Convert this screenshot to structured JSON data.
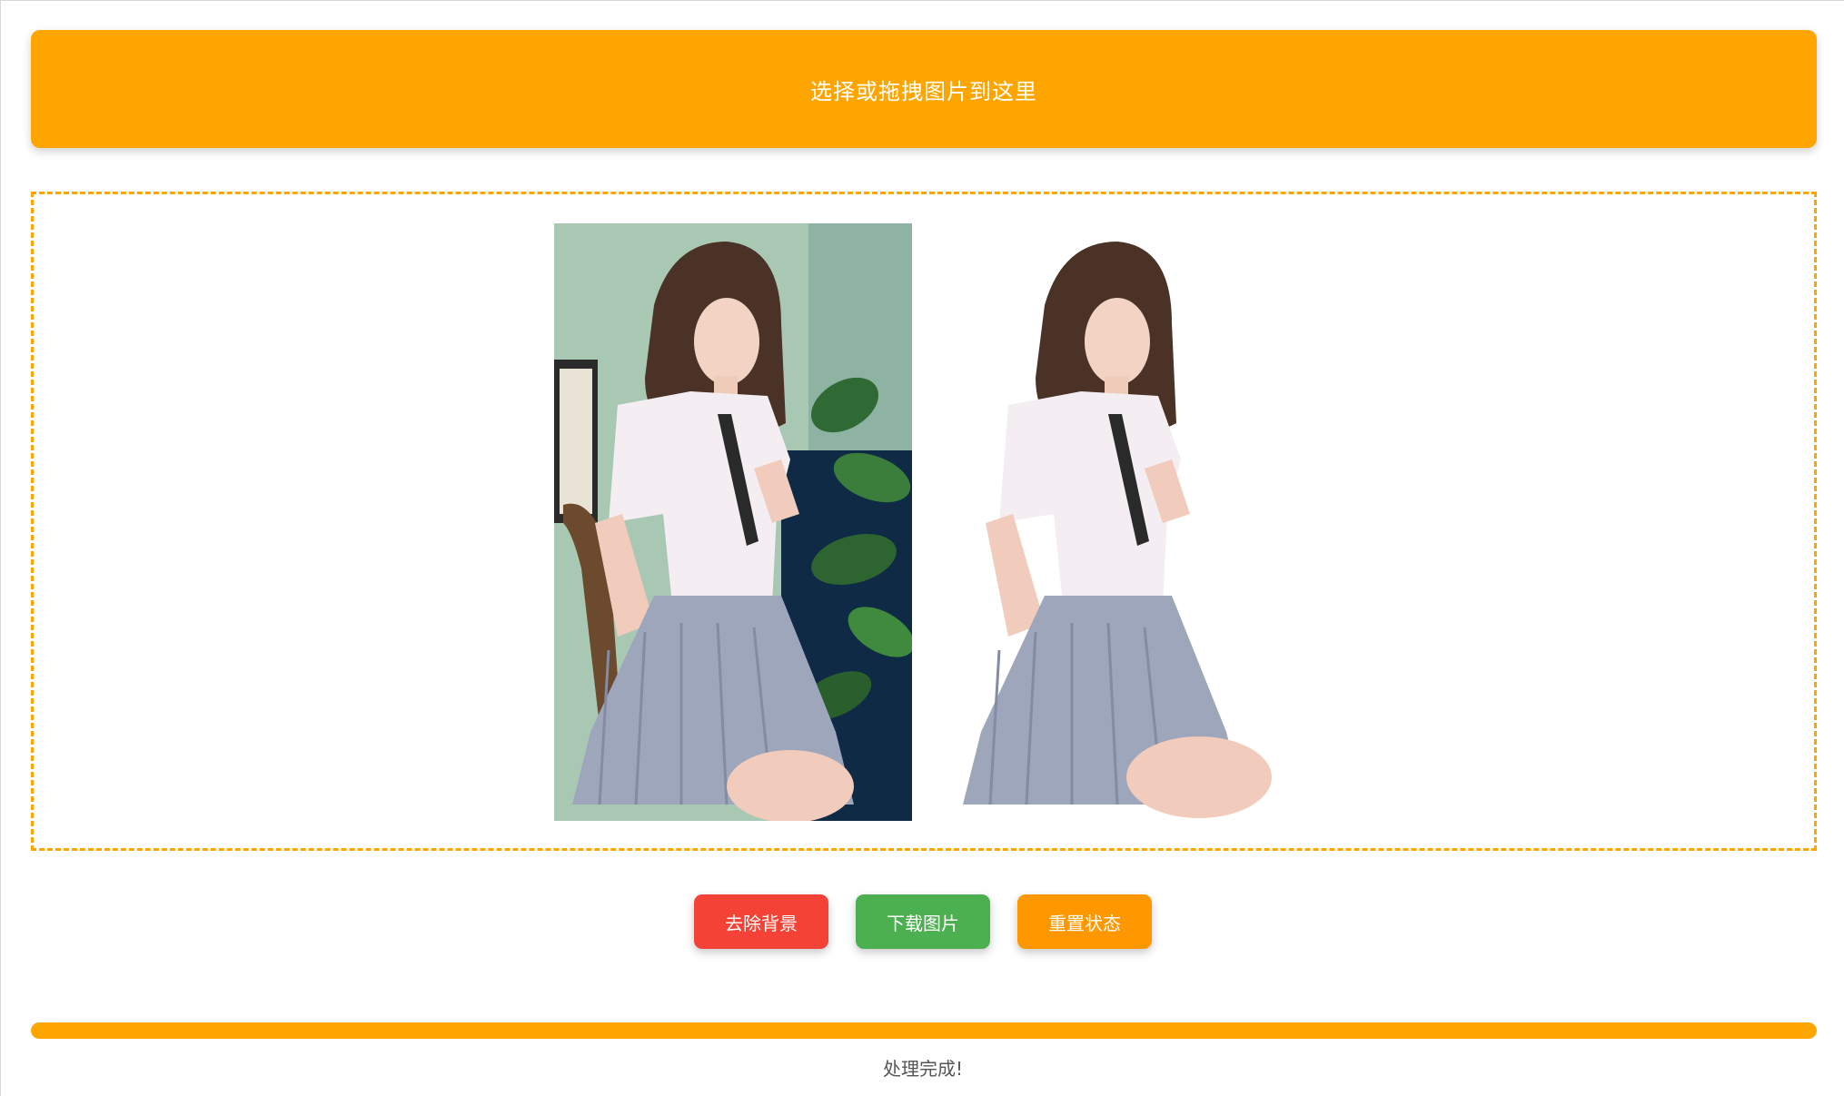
{
  "upload": {
    "label": "选择或拖拽图片到这里"
  },
  "preview": {
    "original_image": "portrait-photo",
    "result_image": "portrait-photo-background-removed"
  },
  "actions": {
    "remove_bg_label": "去除背景",
    "download_label": "下载图片",
    "reset_label": "重置状态"
  },
  "progress": {
    "percent": 100
  },
  "status": {
    "text": "处理完成!"
  },
  "colors": {
    "accent": "#ffa500",
    "remove_button": "#f44336",
    "download_button": "#4caf50",
    "reset_button": "#ff9800"
  }
}
